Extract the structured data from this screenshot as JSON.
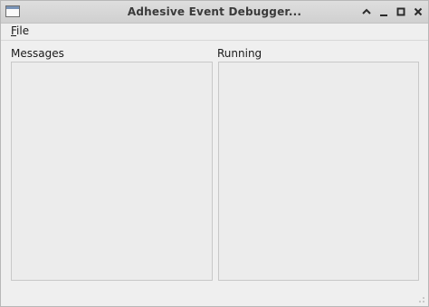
{
  "window": {
    "title": "Adhesive Event Debugger..."
  },
  "titlebar_buttons": [
    {
      "name": "shade",
      "glyph": "˄"
    },
    {
      "name": "minimize",
      "glyph": "–"
    },
    {
      "name": "maximize",
      "glyph": "□"
    },
    {
      "name": "close",
      "glyph": "✕"
    }
  ],
  "menu": {
    "file_mnemonic": "F",
    "file_rest": "ile"
  },
  "panels": {
    "messages_label": "Messages",
    "running_label": "Running"
  },
  "colors": {
    "window_bg": "#efefef",
    "pane_border": "#c8c8c8",
    "titlebar": "#d6d6d6"
  }
}
